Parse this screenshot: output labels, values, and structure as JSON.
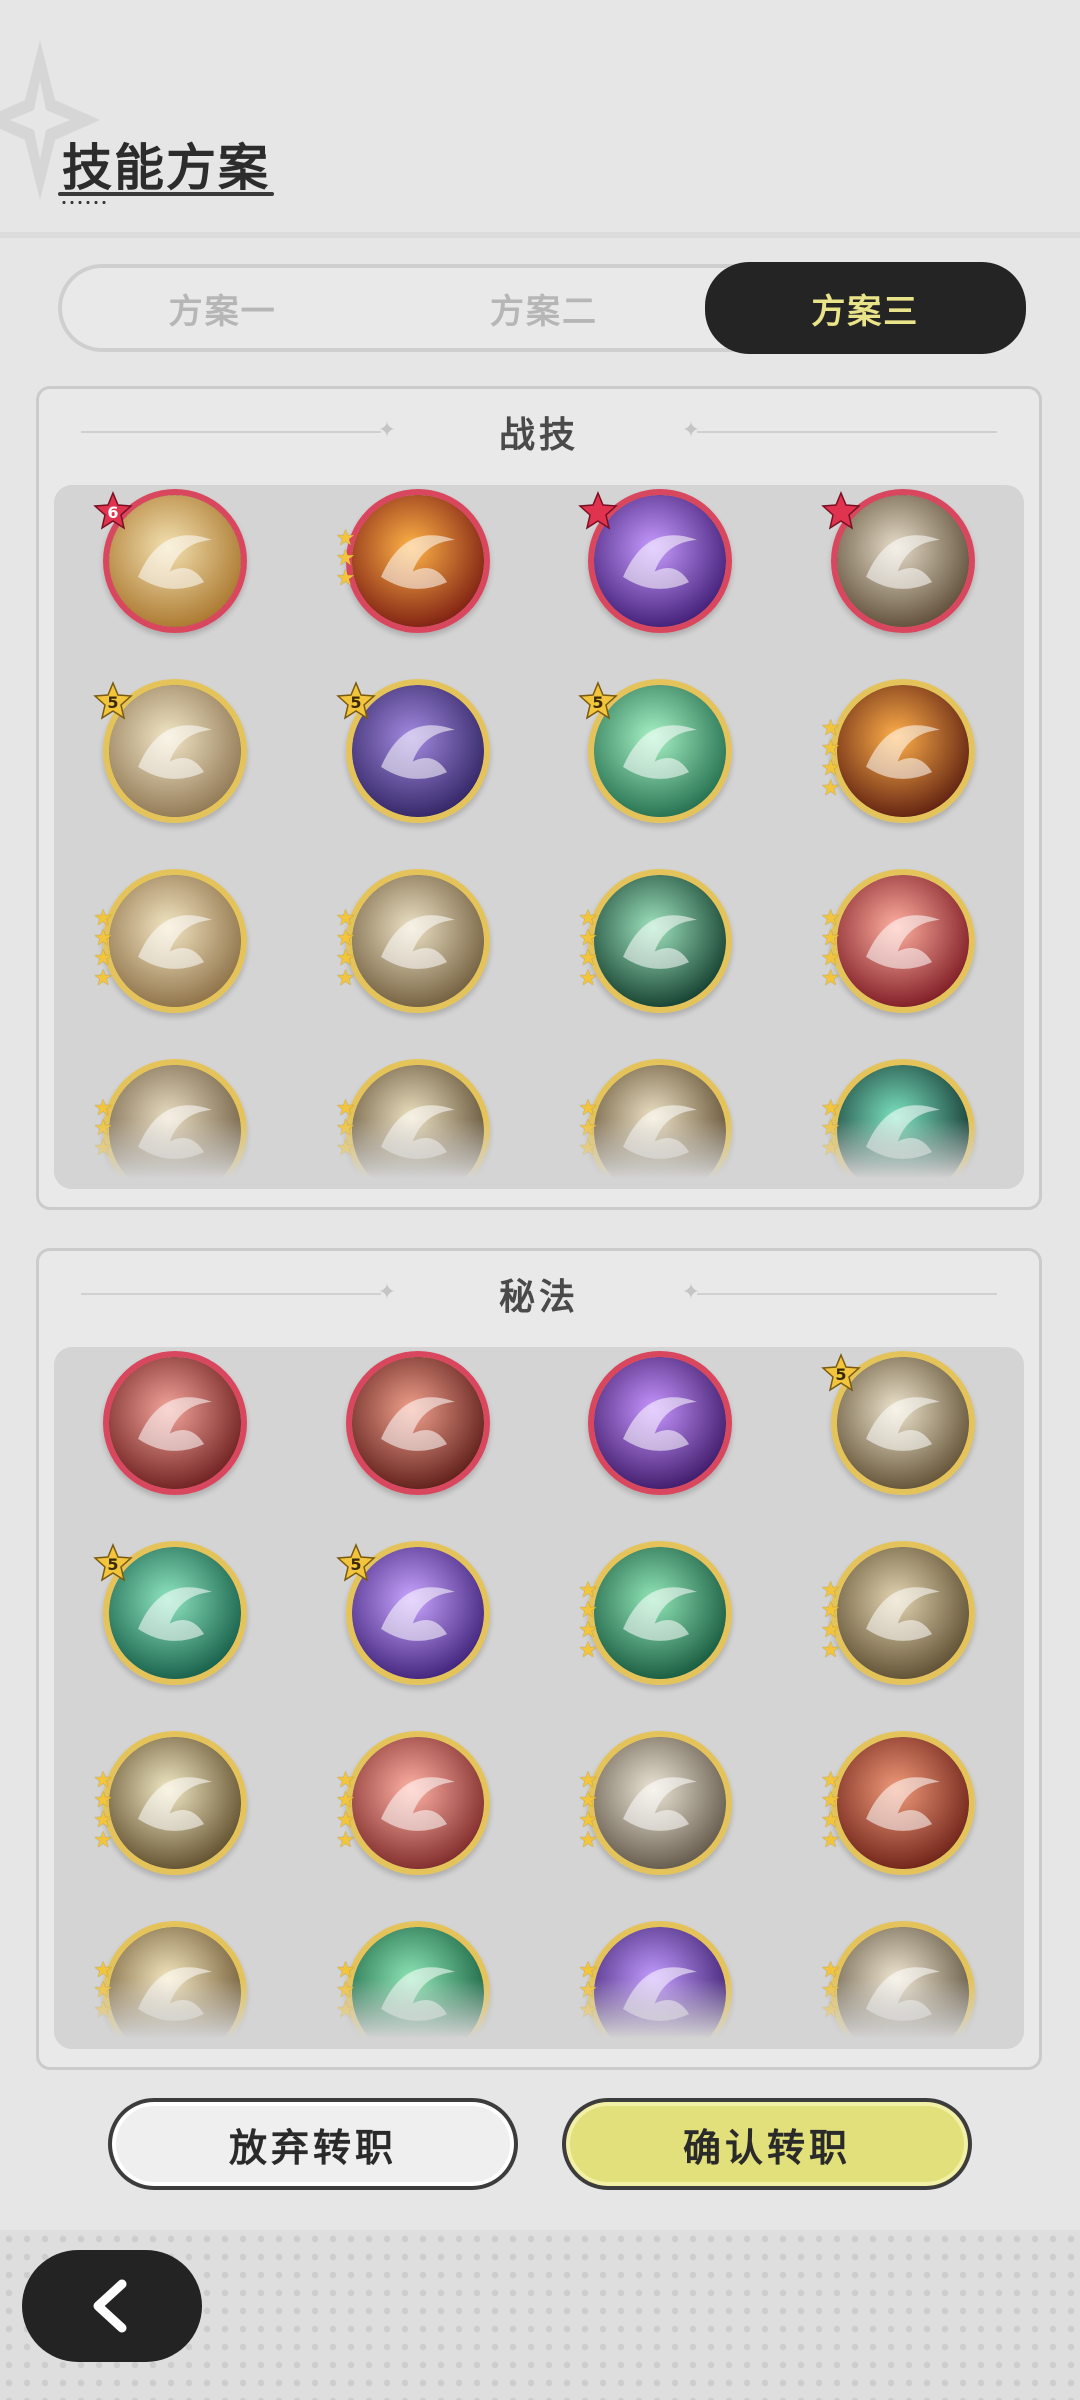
{
  "header": {
    "title": "技能方案"
  },
  "tabs": [
    {
      "label": "方案一",
      "active": false
    },
    {
      "label": "方案二",
      "active": false
    },
    {
      "label": "方案三",
      "active": true
    }
  ],
  "sections": [
    {
      "title": "战技",
      "skills": [
        {
          "icon": "golden-swirl-icon",
          "frame": "red",
          "rank": "6",
          "stars": 0
        },
        {
          "icon": "fire-swirl-icon",
          "frame": "red",
          "rank": "",
          "stars": 3
        },
        {
          "icon": "purple-heart-icon",
          "frame": "red",
          "rank": "★",
          "stars": 0
        },
        {
          "icon": "grasping-hand-icon",
          "frame": "red",
          "rank": "★",
          "stars": 0
        },
        {
          "icon": "whirlwind-icon",
          "frame": "gold",
          "rank": "5",
          "stars": 0
        },
        {
          "icon": "shadow-claw-icon",
          "frame": "gold",
          "rank": "5",
          "stars": 0
        },
        {
          "icon": "green-rising-arrows-icon",
          "frame": "gold",
          "rank": "5",
          "stars": 0
        },
        {
          "icon": "flame-ring-icon",
          "frame": "gold",
          "rank": "",
          "stars": 4
        },
        {
          "icon": "crystal-burst-icon",
          "frame": "gold",
          "rank": "",
          "stars": 4
        },
        {
          "icon": "spin-slash-icon",
          "frame": "gold",
          "rank": "",
          "stars": 4
        },
        {
          "icon": "green-slash-icon",
          "frame": "gold",
          "rank": "",
          "stars": 4
        },
        {
          "icon": "blade-pierce-icon",
          "frame": "gold",
          "rank": "",
          "stars": 4
        },
        {
          "icon": "afterimage-icon",
          "frame": "gold",
          "rank": "",
          "stars": 3
        },
        {
          "icon": "sword-arc-icon",
          "frame": "gold",
          "rank": "",
          "stars": 3
        },
        {
          "icon": "leap-strike-icon",
          "frame": "gold",
          "rank": "",
          "stars": 3
        },
        {
          "icon": "web-icon",
          "frame": "gold",
          "rank": "",
          "stars": 3
        }
      ]
    },
    {
      "title": "秘法",
      "skills": [
        {
          "icon": "crimson-sphere-icon",
          "frame": "red",
          "rank": "",
          "stars": 0
        },
        {
          "icon": "armor-icon",
          "frame": "red",
          "rank": "",
          "stars": 0
        },
        {
          "icon": "purple-flame-icon",
          "frame": "red",
          "rank": "",
          "stars": 0
        },
        {
          "icon": "leaf-emblem-icon",
          "frame": "gold",
          "rank": "5",
          "stars": 0
        },
        {
          "icon": "healing-field-icon",
          "frame": "gold",
          "rank": "5",
          "stars": 0
        },
        {
          "icon": "purple-aura-icon",
          "frame": "gold",
          "rank": "5",
          "stars": 0
        },
        {
          "icon": "green-leaf-icon",
          "frame": "gold",
          "rank": "",
          "stars": 4
        },
        {
          "icon": "fist-icon",
          "frame": "gold",
          "rank": "",
          "stars": 4
        },
        {
          "icon": "eye-icon",
          "frame": "gold",
          "rank": "",
          "stars": 4
        },
        {
          "icon": "sword-heal-icon",
          "frame": "gold",
          "rank": "",
          "stars": 4
        },
        {
          "icon": "sword-shield-icon",
          "frame": "gold",
          "rank": "",
          "stars": 4
        },
        {
          "icon": "red-stone-icon",
          "frame": "gold",
          "rank": "",
          "stars": 4
        },
        {
          "icon": "vortex-icon",
          "frame": "gold",
          "rank": "",
          "stars": 3
        },
        {
          "icon": "green-heart-icon",
          "frame": "gold",
          "rank": "",
          "stars": 3
        },
        {
          "icon": "purple-wing-icon",
          "frame": "gold",
          "rank": "",
          "stars": 3
        },
        {
          "icon": "sword-up-icon",
          "frame": "gold",
          "rank": "",
          "stars": 3
        }
      ]
    }
  ],
  "buttons": {
    "cancel_label": "放弃转职",
    "confirm_label": "确认转职"
  },
  "nav": {
    "back_icon": "chevron-left-icon"
  },
  "colors": {
    "accent": "#e2e07a",
    "active_tab_bg": "#242424",
    "active_tab_text": "#e9e38a",
    "red_frame": "#d9475f",
    "gold_frame": "#e4c45a"
  }
}
